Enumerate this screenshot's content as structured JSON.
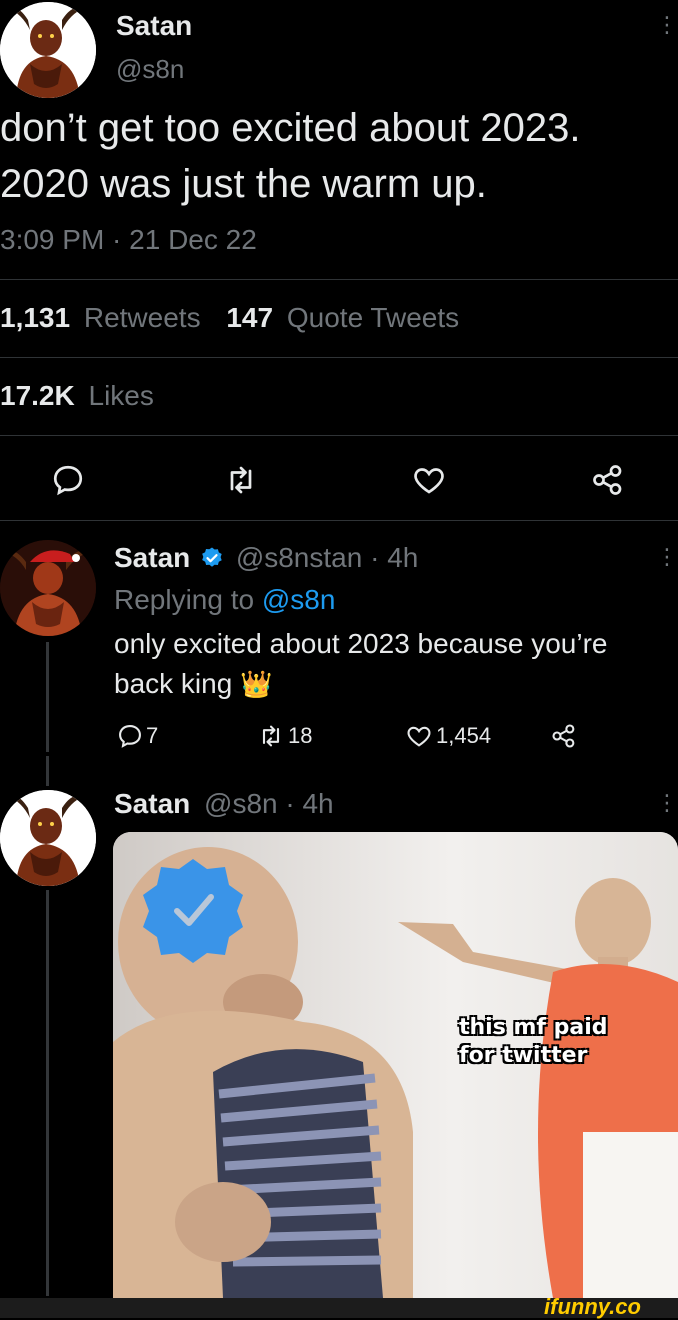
{
  "main_tweet": {
    "display_name": "Satan",
    "handle": "@s8n",
    "text_line1": "don’t get too excited about 2023.",
    "text_line2": "2020 was just the warm up.",
    "timestamp": "3:09 PM · 21 Dec 22",
    "retweets_count": "1,131",
    "retweets_label": "Retweets",
    "quotes_count": "147",
    "quotes_label": "Quote Tweets",
    "likes_count": "17.2K",
    "likes_label": "Likes"
  },
  "reply1": {
    "display_name": "Satan",
    "handle_time": "@s8nstan · 4h",
    "replying_prefix": "Replying to",
    "replying_handle": "@s8n",
    "text_line1": "only excited about 2023 because you’re",
    "text_line2": "back king",
    "emoji": "👑",
    "reply_count": "7",
    "retweet_count": "18",
    "like_count": "1,454"
  },
  "reply2": {
    "display_name": "Satan",
    "handle_time": "@s8n · 4h",
    "meme_caption_line1": "this mf paid",
    "meme_caption_line2": "for twitter"
  },
  "watermark": "ifunny.co",
  "colors": {
    "background": "#000000",
    "text": "#e7e9ea",
    "muted": "#71767b",
    "accent": "#1d9bf0",
    "divider": "#2f3336"
  }
}
